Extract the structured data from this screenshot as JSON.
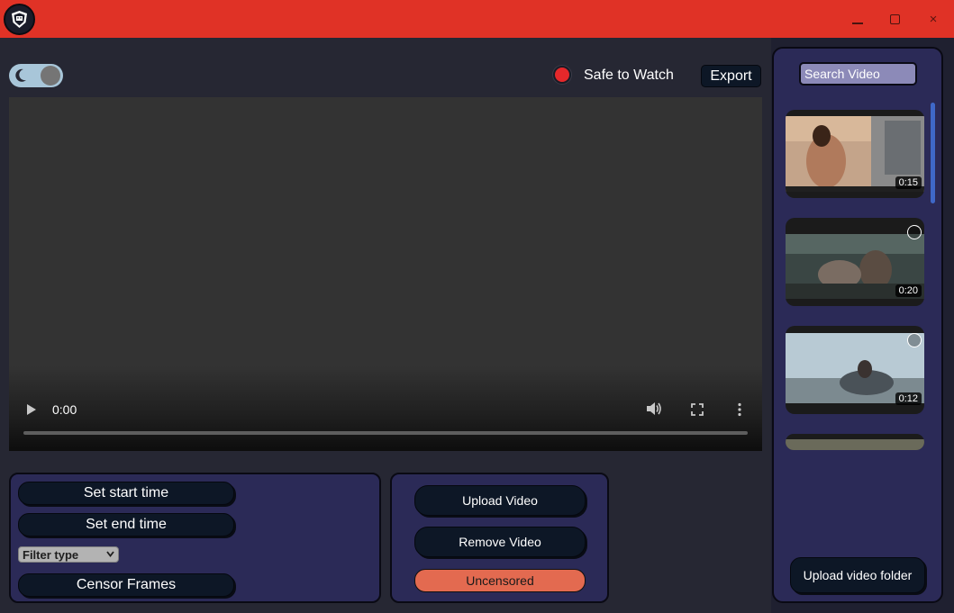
{
  "titlebar": {
    "logo_icon": "shield-logo-icon",
    "accent_color": "#e03226",
    "controls": {
      "minimize_icon": "minimize-icon",
      "maximize_icon": "maximize-icon",
      "close_icon": "close-icon",
      "close_glyph": "×"
    }
  },
  "header": {
    "theme_toggle": {
      "mode": "dark",
      "icon": "moon-icon",
      "on": true
    },
    "status": {
      "text": "Safe to Watch",
      "color": "#e5282b"
    },
    "export_label": "Export"
  },
  "player": {
    "current_time": "0:00",
    "progress": 0,
    "controls": [
      "play-icon",
      "volume-icon",
      "fullscreen-icon",
      "more-vert-icon"
    ]
  },
  "controls_panel": {
    "set_start_label": "Set start time",
    "set_end_label": "Set end time",
    "filter_select": {
      "selected": "Filter type"
    },
    "censor_label": "Censor Frames"
  },
  "actions_panel": {
    "upload_label": "Upload Video",
    "remove_label": "Remove Video",
    "uncensored_label": "Uncensored",
    "uncensored_color": "#e36a50"
  },
  "sidebar": {
    "search_placeholder": "Search Video",
    "videos": [
      {
        "duration": "0:15"
      },
      {
        "duration": "0:20"
      },
      {
        "duration": "0:12"
      }
    ],
    "upload_folder_label": "Upload video folder"
  }
}
